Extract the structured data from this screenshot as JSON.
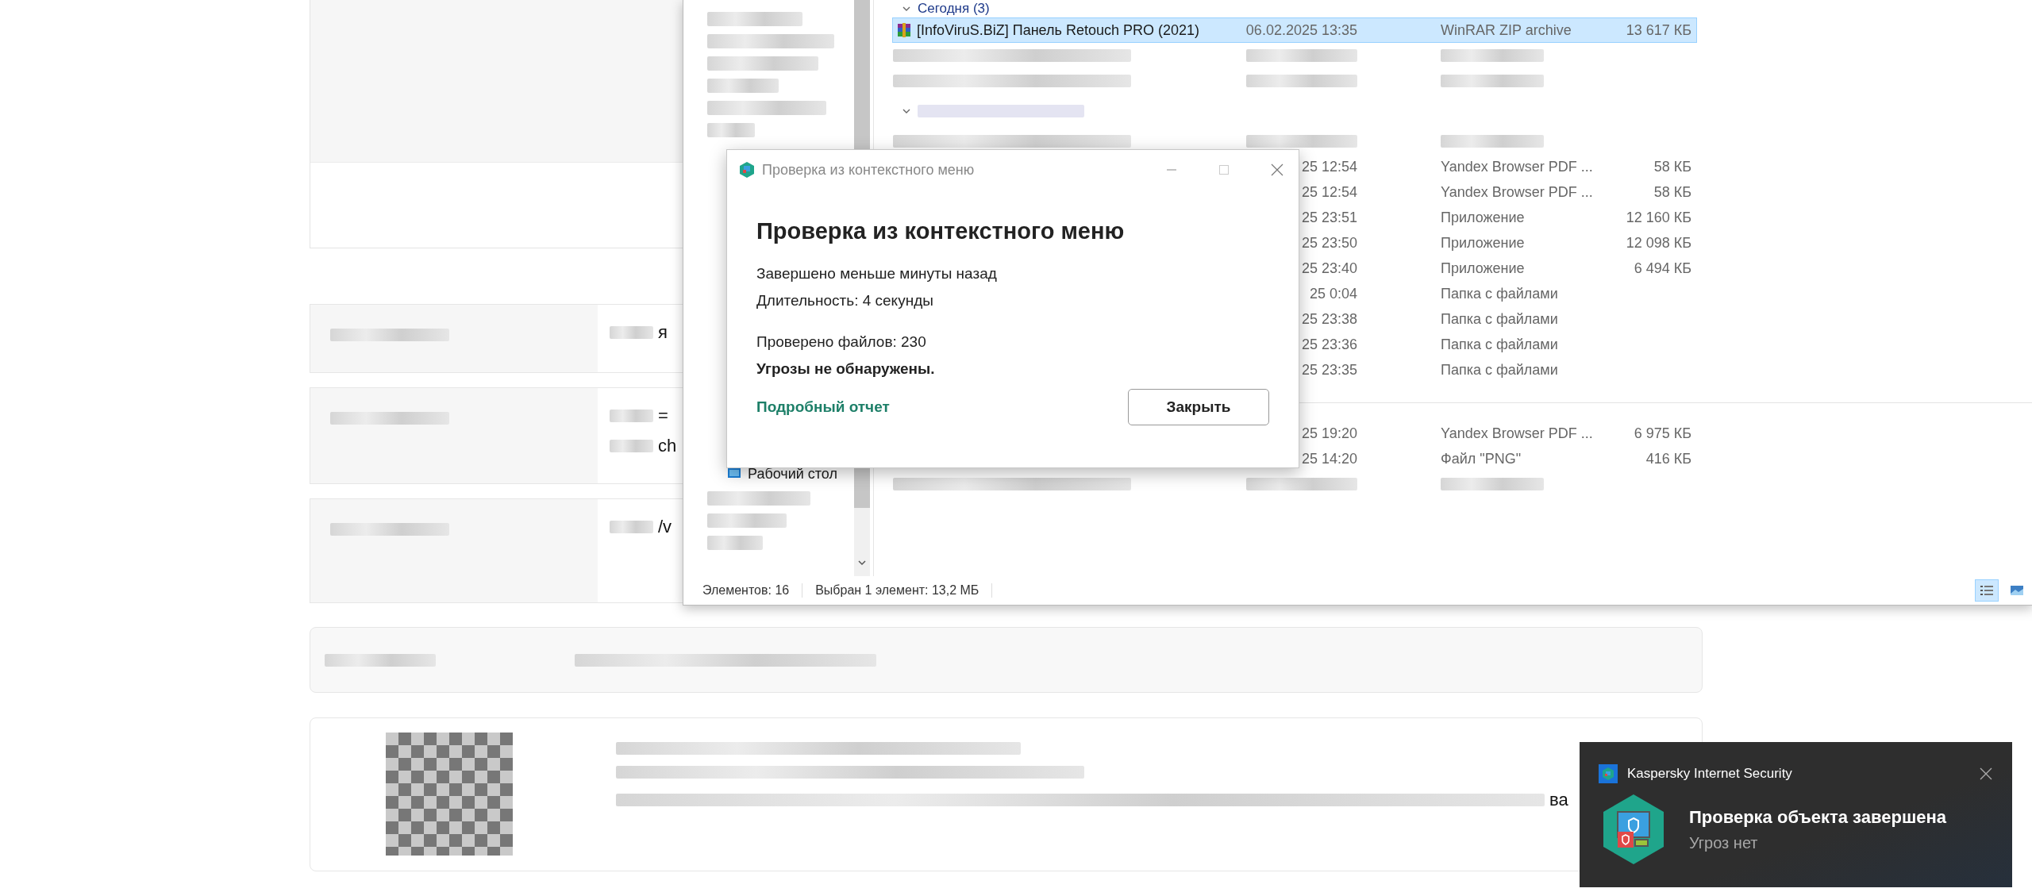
{
  "web_page": {
    "table_rows": [
      {
        "fragments": [
          "я"
        ]
      },
      {
        "fragments": [
          "=",
          "ch"
        ]
      },
      {
        "fragments": [
          "/v"
        ]
      }
    ],
    "bottom_card": {
      "fragment": "ва"
    }
  },
  "explorer": {
    "sidebar": {
      "items": [
        {
          "label": "Рабочий стол"
        }
      ]
    },
    "groups": [
      {
        "label": "Сегодня (3)",
        "expanded": true,
        "rows": [
          {
            "kind": "archive",
            "name": "[InfoViruS.BiZ] Панель Retouch PRO (2021)",
            "date": "06.02.2025 13:35",
            "type": "WinRAR ZIP archive",
            "size": "13 617 КБ",
            "selected": true
          },
          {
            "kind": "blurred",
            "selected": false
          },
          {
            "kind": "blurred",
            "selected": false
          }
        ]
      },
      {
        "expanded": true,
        "rows": [
          {
            "kind": "blurred",
            "selected": false
          },
          {
            "kind": "partial",
            "date": "25 12:54",
            "type": "Yandex Browser PDF ...",
            "size": "58 КБ",
            "selected": false
          },
          {
            "kind": "partial",
            "date": "25 12:54",
            "type": "Yandex Browser PDF ...",
            "size": "58 КБ",
            "selected": false
          },
          {
            "kind": "partial",
            "date": "25 23:51",
            "type": "Приложение",
            "size": "12 160 КБ",
            "selected": false
          },
          {
            "kind": "partial",
            "date": "25 23:50",
            "type": "Приложение",
            "size": "12 098 КБ",
            "selected": false
          },
          {
            "kind": "partial",
            "date": "25 23:40",
            "type": "Приложение",
            "size": "6 494 КБ",
            "selected": false
          },
          {
            "kind": "partial",
            "date": "25 0:04",
            "type": "Папка с файлами",
            "selected": false
          },
          {
            "kind": "partial",
            "date": "25 23:38",
            "type": "Папка с файлами",
            "selected": false
          },
          {
            "kind": "partial",
            "date": "25 23:36",
            "type": "Папка с файлами",
            "selected": false
          },
          {
            "kind": "partial",
            "date": "25 23:35",
            "type": "Папка с файлами",
            "selected": false
          }
        ]
      },
      {
        "rows": [
          {
            "kind": "partial",
            "date": "25 19:20",
            "type": "Yandex Browser PDF ...",
            "size": "6 975 КБ",
            "selected": false
          },
          {
            "kind": "partial",
            "date": "25 14:20",
            "type": "Файл \"PNG\"",
            "size": "416 КБ",
            "selected": false
          },
          {
            "kind": "blurred",
            "selected": false
          }
        ]
      }
    ],
    "status_bar": {
      "item_count": "Элементов: 16",
      "selection": "Выбран 1 элемент: 13,2 МБ",
      "views": [
        {
          "kind": "details",
          "selected": true
        },
        {
          "kind": "thumbnails",
          "selected": false
        }
      ]
    }
  },
  "dialog": {
    "title": "Проверка из контекстного меню",
    "heading": "Проверка из контекстного меню",
    "lines": [
      "Завершено меньше минуты назад",
      "Длительность: 4 секунды"
    ],
    "files_checked": "Проверено файлов: 230",
    "result": "Угрозы не обнаружены.",
    "report_link": "Подробный отчет",
    "close_button": "Закрыть"
  },
  "notification": {
    "app": "Kaspersky Internet Security",
    "title": "Проверка объекта завершена",
    "message": "Угроз нет"
  }
}
